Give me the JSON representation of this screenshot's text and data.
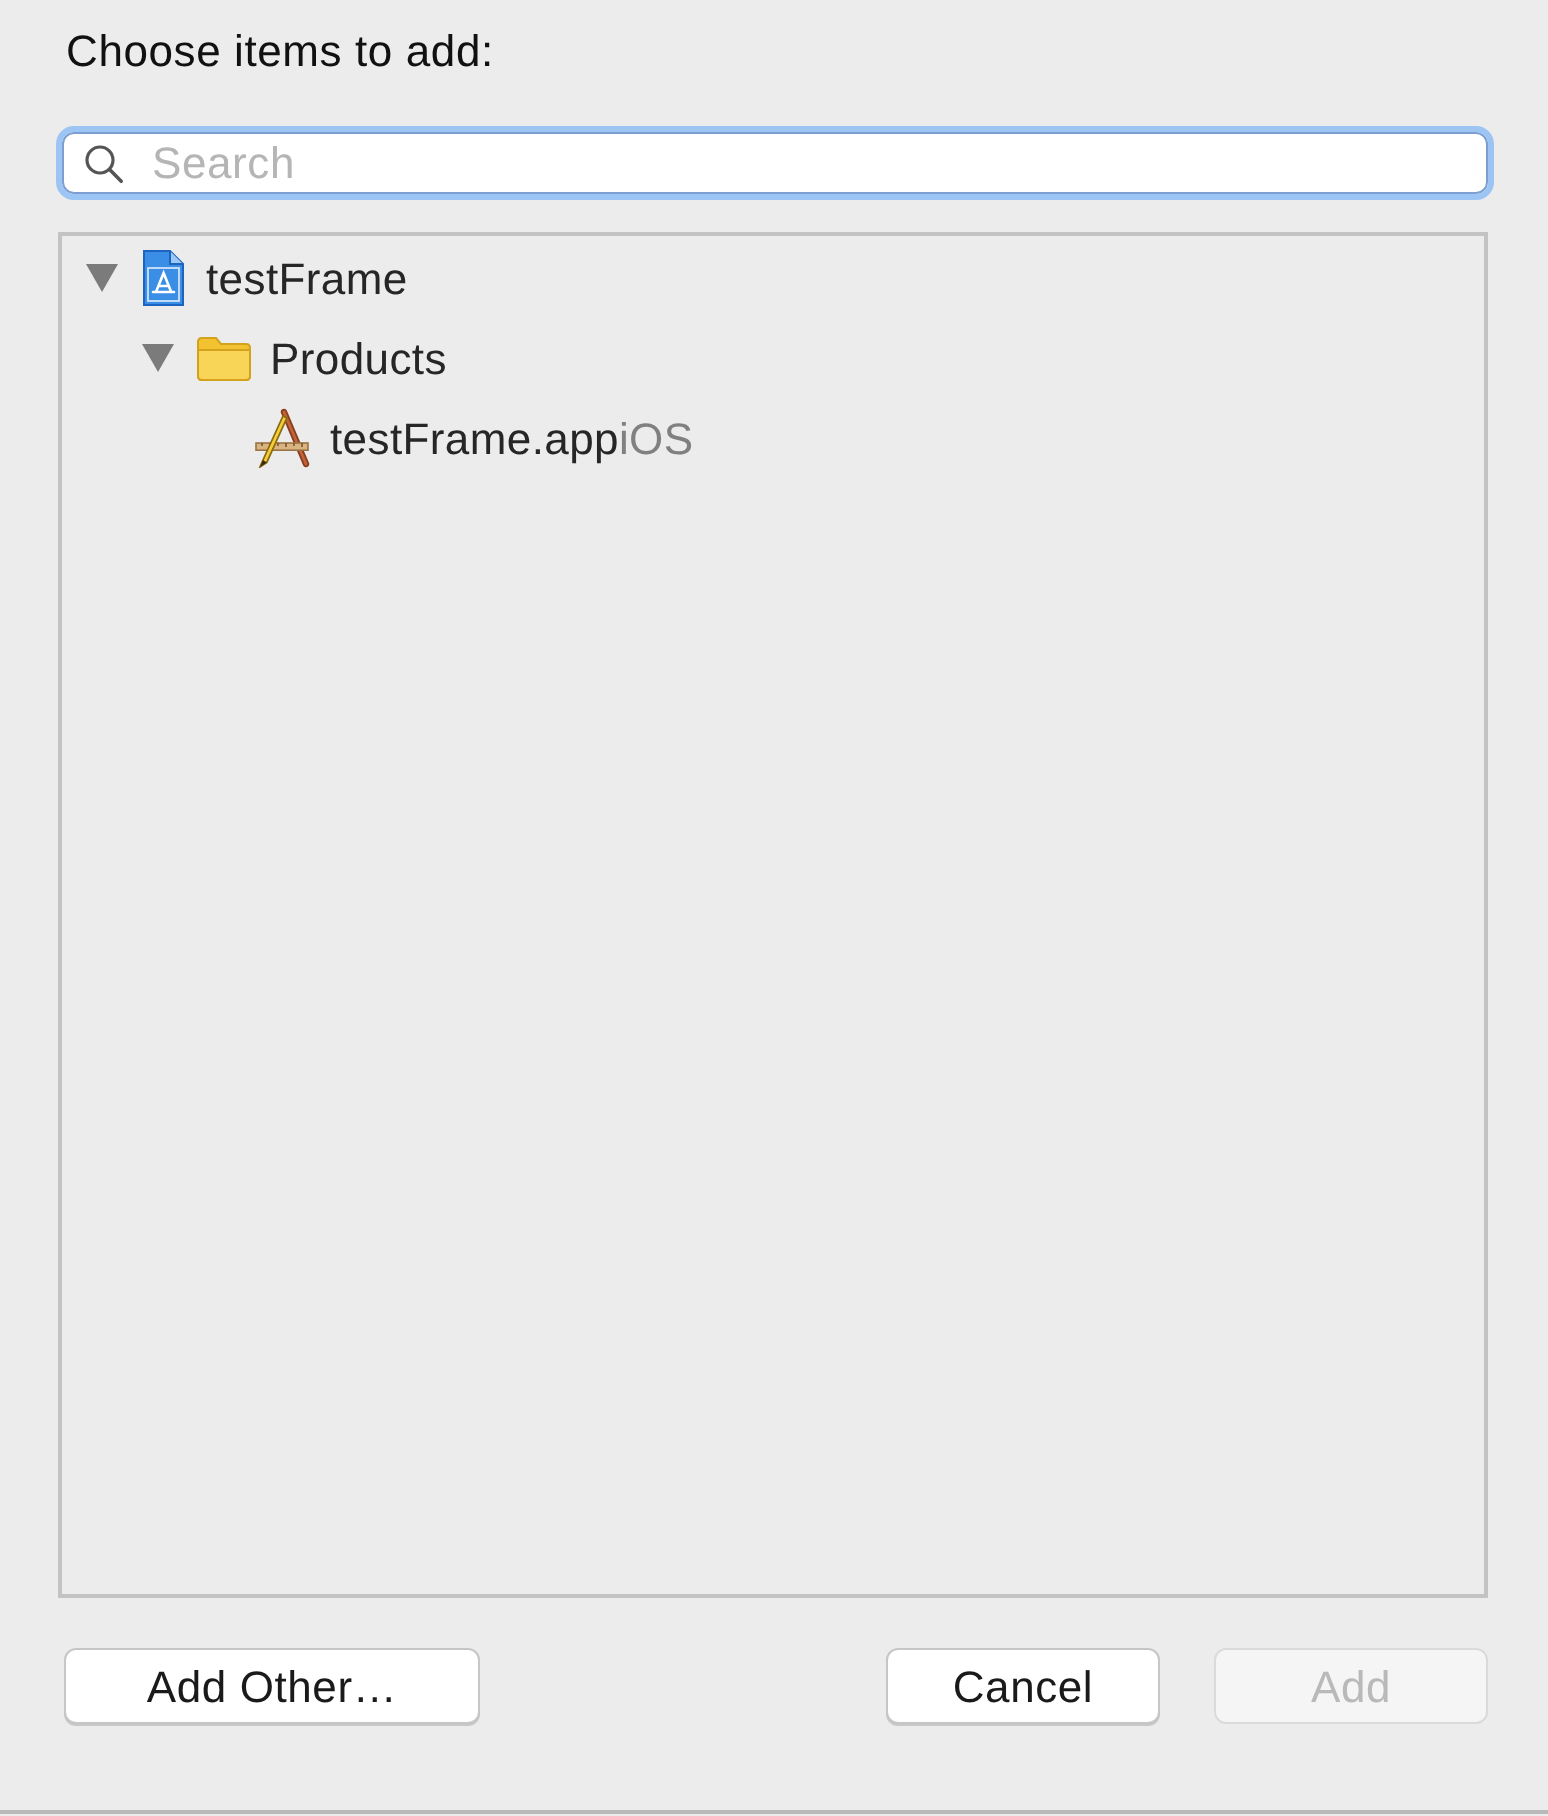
{
  "dialog": {
    "prompt": "Choose items to add:"
  },
  "search": {
    "placeholder": "Search",
    "focused": true
  },
  "tree": {
    "items": [
      {
        "kind": "project",
        "label": "testFrame",
        "expanded": true,
        "selected": false,
        "children": [
          {
            "kind": "folder",
            "label": "Products",
            "expanded": true,
            "selected": false,
            "children": [
              {
                "kind": "app",
                "label": "testFrame.app",
                "platform": "iOS",
                "selected": false
              }
            ]
          }
        ]
      }
    ]
  },
  "footer": {
    "left_buttons": [
      {
        "label": "Add Other…",
        "disabled": false
      }
    ],
    "right_buttons": [
      {
        "label": "Cancel",
        "disabled": false
      },
      {
        "label": "Add",
        "disabled": true
      }
    ]
  }
}
